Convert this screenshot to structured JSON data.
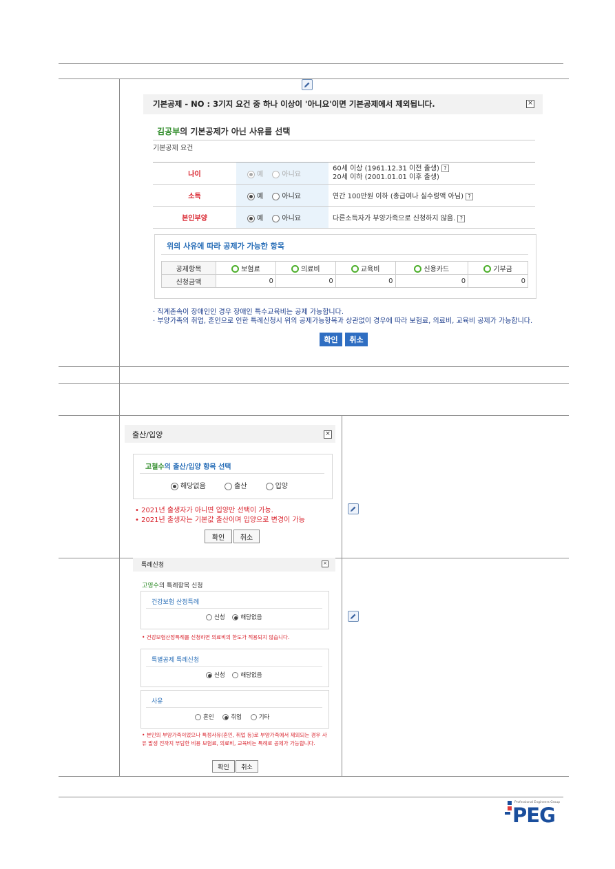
{
  "dialog1": {
    "header": "기본공제 - NO : 3기지 요건 중 하나 이상이 '아니요'이면 기본공제에서 제외됩니다.",
    "subtitle_name": "김공부",
    "subtitle_rest": "의 기본공제가 아닌 사유를 선택",
    "section_label": "기본공제 요건",
    "rows": [
      {
        "label": "나이",
        "yes": "예",
        "no": "아니요",
        "desc1": "60세 이상 (1961.12.31 이전 출생)",
        "desc2": "20세 이하 (2001.01.01 이후 출생)"
      },
      {
        "label": "소득",
        "yes": "예",
        "no": "아니요",
        "desc1": "연간 100만원 이하 (총급여나 실수령액 아님)",
        "desc2": ""
      },
      {
        "label": "본인부양",
        "yes": "예",
        "no": "아니요",
        "desc1": "다른소득자가 부양가족으로 신청하지 않음.",
        "desc2": ""
      }
    ],
    "deduct_title": "위의 사유에 따라 공제가 가능한 항목",
    "deduct_head": "공제항목",
    "deduct_items": [
      "보험료",
      "의료비",
      "교육비",
      "신용카드",
      "기부금"
    ],
    "amount_label": "신청금액",
    "amounts": [
      "0",
      "0",
      "0",
      "0",
      "0"
    ],
    "note1": "· 직계존속이 장애인인 경우 장애인 특수교육비는 공제 가능합니다.",
    "note2": "· 부양가족의 취업, 혼인으로 인한 특례신청시 위의 공제가능항목과 상관없이 경우에 따라 보험료, 의료비, 교육비 공제가 가능합니다.",
    "ok": "확인",
    "cancel": "취소"
  },
  "dialog2": {
    "title": "출산/입양",
    "subtitle_name": "고철수",
    "subtitle_rest": "의 출산/입양 항목 선택",
    "options": [
      "해당없음",
      "출산",
      "입양"
    ],
    "note1": "• 2021년 출생자가 아니면 입양만 선택이 가능.",
    "note2": "• 2021년 출생자는 기본값 출산이며 입양으로 변경이 가능",
    "ok": "확인",
    "cancel": "취소"
  },
  "dialog3": {
    "title": "특례신청",
    "subtitle_name": "고영수",
    "subtitle_rest": "의 특례항목 신청",
    "box1_title": "건강보험 산정특례",
    "box1_opts": [
      "신청",
      "해당없음"
    ],
    "box1_note": "• 건강보험산정특례를 신청하면 의료비의 한도가 적용되지 않습니다.",
    "box2_title": "특별공제 특례신청",
    "box2_opts": [
      "신청",
      "해당없음"
    ],
    "box3_title": "사유",
    "box3_opts": [
      "혼인",
      "취업",
      "기타"
    ],
    "note": "• 본인의 부양가족이었으나 특정사유(혼인, 취업 등)로 부양가족에서 제외되는 경우 사유 발생 전까지 부담한 비용 보험료, 의료비, 교육비는 특례로 공제가 가능합니다.",
    "ok": "확인",
    "cancel": "취소"
  },
  "logo": {
    "text": "PEG",
    "tagline": "Professional Engineers Group",
    "color": "#1a4e9c",
    "accent": "#e03a3a"
  }
}
